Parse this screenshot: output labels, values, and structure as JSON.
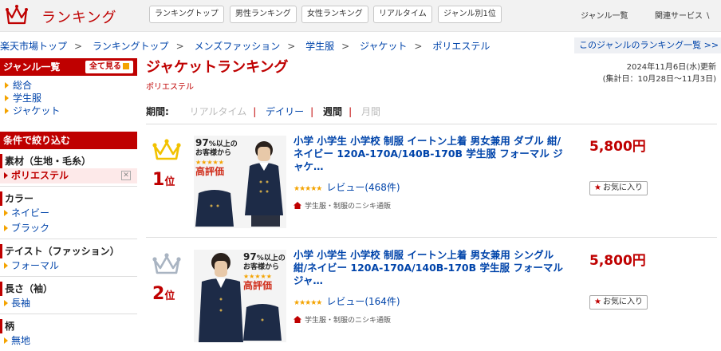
{
  "header": {
    "logo_text": "ランキング",
    "nav": [
      "ランキングトップ",
      "男性ランキング",
      "女性ランキング",
      "リアルタイム",
      "ジャンル別1位"
    ],
    "genre_list": "ジャンル一覧",
    "related_services": "関連サービス ∖"
  },
  "breadcrumb": [
    "楽天市場トップ",
    "ランキングトップ",
    "メンズファッション",
    "学生服",
    "ジャケット",
    "ポリエステル"
  ],
  "genre_ranking_link": "このジャンルのランキング一覧 >>",
  "sidebar": {
    "genre_heading": "ジャンル一覧",
    "see_all": "全て見る",
    "genres": [
      "総合",
      "学生服",
      "ジャケット"
    ],
    "filter_heading": "条件で絞り込む",
    "filters": [
      {
        "title": "素材（生地・毛糸）",
        "items": [
          "ポリエステル"
        ],
        "selected": "ポリエステル"
      },
      {
        "title": "カラー",
        "items": [
          "ネイビー",
          "ブラック"
        ]
      },
      {
        "title": "テイスト（ファッション）",
        "items": [
          "フォーマル"
        ]
      },
      {
        "title": "長さ（袖）",
        "items": [
          "長袖"
        ]
      },
      {
        "title": "柄",
        "items": [
          "無地"
        ]
      }
    ]
  },
  "main": {
    "title": "ジャケットランキング",
    "subtitle": "ポリエステル",
    "updated": "2024年11月6日(水)更新",
    "period_range": "(集計日：10月28日～11月3日)",
    "period_label": "期間:",
    "periods": [
      "リアルタイム",
      "デイリー",
      "週間",
      "月間"
    ],
    "items": [
      {
        "rank": "1",
        "rank_suffix": "位",
        "title": "小学 小学生 小学校 制服 イートン上着 男女兼用 ダブル 紺/ネイビー 120A-170A/140B-170B 学生服 フォーマル ジャケ…",
        "price": "5,800円",
        "rating": "4.5",
        "review_text": "レビュー(468件)",
        "shop": "学生服・制服のニシキ通販",
        "fav_label": "お気に入り",
        "badge": {
          "line1": "97",
          "pct": "%以上の",
          "line2": "お客様から",
          "stars": "★★★★★",
          "line3": "高評価"
        },
        "crown": "gold"
      },
      {
        "rank": "2",
        "rank_suffix": "位",
        "title": "小学 小学生 小学校 制服 イートン上着 男女兼用 シングル 紺/ネイビー 120A-170A/140B-170B 学生服 フォーマル ジャ…",
        "price": "5,800円",
        "rating": "4.5",
        "review_text": "レビュー(164件)",
        "shop": "学生服・制服のニシキ通販",
        "fav_label": "お気に入り",
        "badge": {
          "line1": "97",
          "pct": "%以上の",
          "line2": "お客様から",
          "stars": "★★★★★",
          "line3": "高評価"
        },
        "crown": "silver"
      }
    ]
  },
  "colors": {
    "brand_red": "#bf0000",
    "link_blue": "#0044aa",
    "star_orange": "#f4a300",
    "gold": "#f2c200",
    "silver": "#a9b4c2"
  }
}
